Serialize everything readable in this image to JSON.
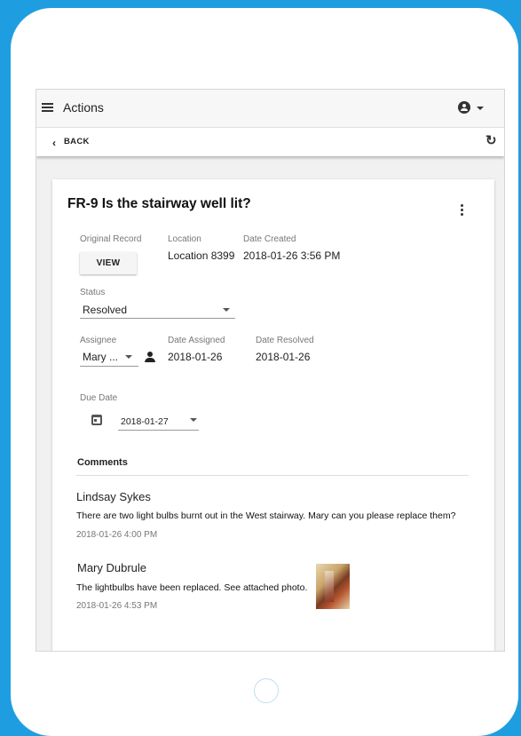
{
  "appbar": {
    "title": "Actions",
    "menu_icon": "hamburger-menu-icon",
    "account_icon": "account-circle-icon"
  },
  "subbar": {
    "back_label": "BACK",
    "back_icon": "chevron-left-icon",
    "refresh_icon": "refresh-icon"
  },
  "card": {
    "title": "FR-9 Is the stairway well lit?",
    "original_record_label": "Original Record",
    "view_button": "VIEW",
    "location_label": "Location",
    "location_value": "Location 8399",
    "date_created_label": "Date Created",
    "date_created_value": "2018-01-26 3:56 PM",
    "status_label": "Status",
    "status_value": "Resolved",
    "assignee_label": "Assignee",
    "assignee_value": "Mary ...",
    "date_assigned_label": "Date Assigned",
    "date_assigned_value": "2018-01-26",
    "date_resolved_label": "Date Resolved",
    "date_resolved_value": "2018-01-26",
    "due_date_label": "Due Date",
    "due_date_value": "2018-01-27",
    "comments_heading": "Comments"
  },
  "comments": [
    {
      "author": "Lindsay Sykes",
      "text": "There are two light bulbs burnt out in the West stairway. Mary can you please replace them?",
      "time": "2018-01-26 4:00 PM"
    },
    {
      "author": "Mary Dubrule",
      "text": "The lightbulbs have been replaced. See attached photo.",
      "time": "2018-01-26 4:53 PM"
    }
  ],
  "colors": {
    "frame": "#1e9ee0",
    "device": "#ffffff",
    "screen_bg": "#f1f1f1"
  }
}
